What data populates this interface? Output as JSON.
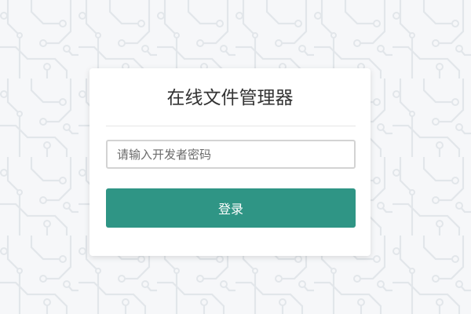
{
  "login": {
    "title": "在线文件管理器",
    "password_placeholder": "请输入开发者密码",
    "password_value": "",
    "submit_label": "登录"
  },
  "colors": {
    "background": "#f6f7f9",
    "card": "#ffffff",
    "accent": "#2f9585",
    "circuit_pattern": "#e4e7eb"
  }
}
